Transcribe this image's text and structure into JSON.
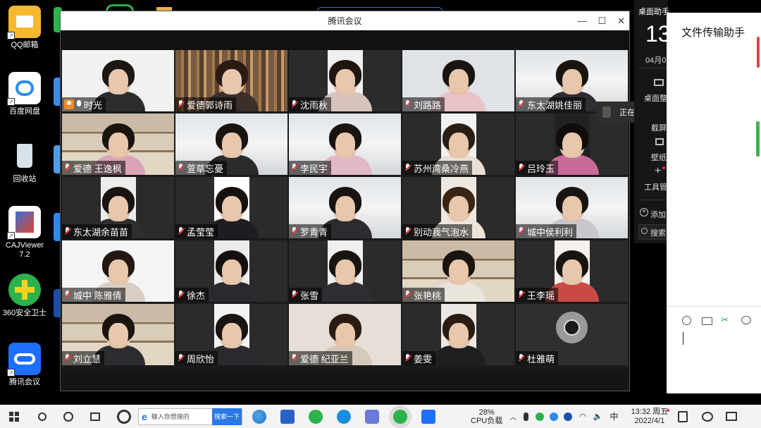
{
  "meeting": {
    "title": "腾讯会议",
    "controls": {
      "minimize": "—",
      "maximize": "☐",
      "close": "✕"
    },
    "participants": [
      {
        "name": "时光",
        "host": true,
        "muted": false,
        "bg": "#f1f1ef",
        "shirt": "#2c2c2c",
        "hair": "#1b1713",
        "room": "bright"
      },
      {
        "name": "爱德郭诗雨",
        "muted": true,
        "bg": "#6e4f3a",
        "shirt": "#3a2f2a",
        "hair": "#2a1b15",
        "room": "books"
      },
      {
        "name": "沈雨秋",
        "muted": true,
        "bg": "#efefef",
        "shirt": "#d8c3bc",
        "hair": "#20160f",
        "room": "narrow"
      },
      {
        "name": "刘路路",
        "muted": true,
        "bg": "#dfe2e6",
        "shirt": "#e7c3c8",
        "hair": "#1a1410",
        "room": "bright"
      },
      {
        "name": "东太湖姚佳丽",
        "muted": true,
        "bg": "#e8ecef",
        "shirt": "#2d2d33",
        "hair": "#1a1410",
        "room": "lamp"
      },
      {
        "name": "爱德 王逸枫",
        "muted": true,
        "bg": "#cdbfae",
        "shirt": "#d9a3b8",
        "hair": "#1a1410",
        "room": "shelf"
      },
      {
        "name": "萱草忘憂",
        "muted": true,
        "bg": "#e6e6e4",
        "shirt": "#2b2b2e",
        "hair": "#1a1410",
        "room": "lamp"
      },
      {
        "name": "李民宇",
        "muted": true,
        "bg": "#e3e7ea",
        "shirt": "#e3b8c6",
        "hair": "#1a1410",
        "room": "lamp"
      },
      {
        "name": "苏州湾桑冷燕",
        "muted": true,
        "bg": "#f2f2f2",
        "shirt": "#e8e0d6",
        "hair": "#2a1d14",
        "room": "narrow"
      },
      {
        "name": "吕玲玉",
        "muted": true,
        "bg": "#222222",
        "shirt": "#c86a9a",
        "hair": "#120c08",
        "room": "narrow-dark"
      },
      {
        "name": "东太湖余苗苗",
        "muted": true,
        "bg": "#ececea",
        "shirt": "#2e2e30",
        "hair": "#1a1410",
        "room": "narrow"
      },
      {
        "name": "孟莹莹",
        "muted": true,
        "bg": "#ffffff",
        "shirt": "#1e1e22",
        "hair": "#15100c",
        "room": "narrow-white"
      },
      {
        "name": "罗青青",
        "muted": true,
        "bg": "#e7ebee",
        "shirt": "#2c2c30",
        "hair": "#1a1410",
        "room": "lamp"
      },
      {
        "name": "别动我气泡水",
        "muted": true,
        "bg": "#efe8e2",
        "shirt": "#ede4da",
        "hair": "#3a2414",
        "room": "narrow"
      },
      {
        "name": "城中侯利利",
        "muted": true,
        "bg": "#e9edf0",
        "shirt": "#c8c8cc",
        "hair": "#1a1410",
        "room": "lamp"
      },
      {
        "name": "城中 陈雅倩",
        "muted": true,
        "bg": "#f4f4f4",
        "shirt": "#d9cfc4",
        "hair": "#231711",
        "room": "bright"
      },
      {
        "name": "徐杰",
        "muted": true,
        "bg": "#ebebeb",
        "shirt": "#2a2a2e",
        "hair": "#141010",
        "room": "narrow"
      },
      {
        "name": "张雪",
        "muted": true,
        "bg": "#efefef",
        "shirt": "#2f2f33",
        "hair": "#1a1410",
        "room": "narrow"
      },
      {
        "name": "张艳桃",
        "muted": true,
        "bg": "#d9cdbc",
        "shirt": "#e9e4dc",
        "hair": "#1a1410",
        "room": "shelf"
      },
      {
        "name": "王李瑶",
        "muted": true,
        "bg": "#f5f1ef",
        "shirt": "#c84a45",
        "hair": "#1a1410",
        "room": "narrow"
      },
      {
        "name": "刘立慧",
        "muted": true,
        "bg": "#d6cab8",
        "shirt": "#2d2d31",
        "hair": "#1a1410",
        "room": "shelf"
      },
      {
        "name": "周欣怡",
        "muted": true,
        "bg": "#f3f3f3",
        "shirt": "#2a2a2e",
        "hair": "#1a1410",
        "room": "narrow"
      },
      {
        "name": "爱德 纪亚兰",
        "muted": true,
        "bg": "#e6dfd8",
        "shirt": "#d6c9bb",
        "hair": "#2a1c12",
        "room": "bright"
      },
      {
        "name": "姜雯",
        "muted": true,
        "bg": "#ece7e2",
        "shirt": "#1f1f22",
        "hair": "#2a1c12",
        "room": "narrow"
      },
      {
        "name": "杜雅萌",
        "muted": true,
        "bg": "#2f2f2f",
        "shirt": "#2f2f2f",
        "hair": "#2f2f2f",
        "room": "avatar"
      }
    ]
  },
  "desktop_icons": [
    {
      "label": "QQ邮箱",
      "color": "#f5b82e"
    },
    {
      "label": "百度网盘",
      "color": "#ffffff"
    },
    {
      "label": "回收站",
      "color": "#d7e2ea"
    },
    {
      "label": "CAJViewer 7.2",
      "color": "#ffffff"
    },
    {
      "label": "360安全卫士",
      "color": "#2bb24c"
    },
    {
      "label": "腾讯会议",
      "color": "#1f6fff"
    }
  ],
  "assistant": {
    "title": "桌面助手",
    "time": "13",
    "date": "04月0",
    "items": [
      "桌面整",
      "截屏",
      "壁纸",
      "工具管"
    ],
    "add": "添加",
    "search": "搜索"
  },
  "file_panel": {
    "title": "文件传输助手"
  },
  "speaking": {
    "label": "正在讲话:"
  },
  "taskbar": {
    "search_placeholder": "输入你想搜的",
    "search_button": "搜索一下",
    "cpu_percent": "28%",
    "cpu_label": "CPU负载",
    "ime": "中",
    "clock_time": "13:32 周五",
    "clock_date": "2022/4/1"
  },
  "colors": {
    "accent": "#1f6fff",
    "host": "#f08c2a"
  }
}
